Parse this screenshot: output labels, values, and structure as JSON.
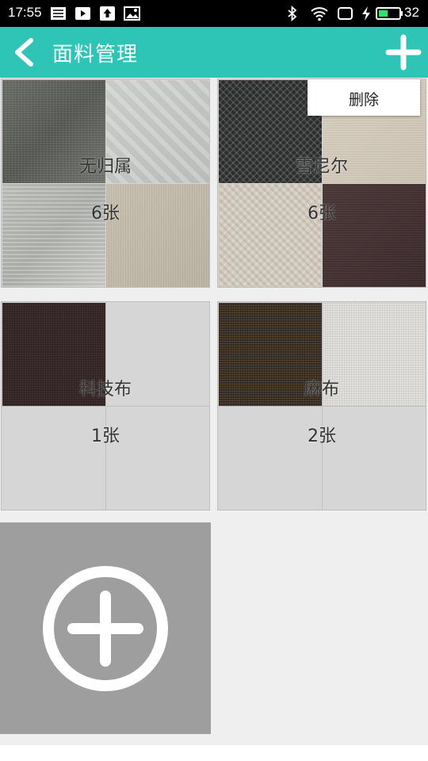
{
  "status_bar": {
    "time": "17:55",
    "battery": "32",
    "icons": [
      "keyboard-icon",
      "play-icon",
      "upload-icon",
      "image-icon",
      "bluetooth-icon",
      "wifi-icon",
      "screen-icon",
      "charging-icon",
      "battery-icon"
    ]
  },
  "app_bar": {
    "title": "面料管理",
    "background": "#2ec4b6",
    "back_icon": "back-arrow-icon",
    "add_icon": "plus-icon"
  },
  "popup": {
    "delete_label": "删除"
  },
  "folders": [
    {
      "name": "无归属",
      "count": "6张",
      "swatches": [
        "grey",
        "lightpattern",
        "silver",
        "beige"
      ]
    },
    {
      "name": "雪尼尔",
      "count": "6张",
      "swatches": [
        "blackweave",
        "cream",
        "herring",
        "brown"
      ]
    },
    {
      "name": "科技布",
      "count": "1张",
      "swatches": [
        "darkbrown"
      ]
    },
    {
      "name": "麻布",
      "count": "2张",
      "swatches": [
        "linen",
        "white"
      ]
    }
  ],
  "add_folder": {
    "icon": "add-circle-icon"
  }
}
